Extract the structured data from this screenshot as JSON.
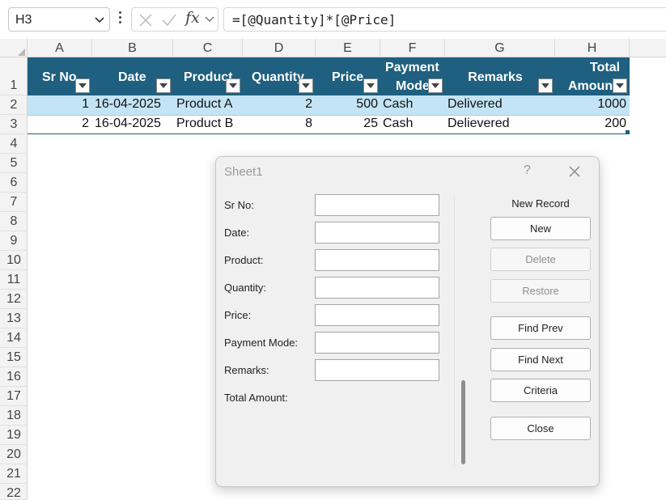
{
  "formula_bar": {
    "name_box": "H3",
    "fx_label": "fx",
    "formula": "=[@Quantity]*[@Price]"
  },
  "columns": [
    "A",
    "B",
    "C",
    "D",
    "E",
    "F",
    "G",
    "H"
  ],
  "rows": [
    "1",
    "2",
    "3",
    "4",
    "5",
    "6",
    "7",
    "8",
    "9",
    "10",
    "11",
    "12",
    "13",
    "14",
    "15",
    "16",
    "17",
    "18",
    "19",
    "20",
    "21",
    "22"
  ],
  "table": {
    "header_color": "#1f5f7f",
    "selected_row_color": "#c3e4f5",
    "headers": {
      "sr_no": "Sr No",
      "date": "Date",
      "product": "Product",
      "quantity": "Quantity",
      "price": "Price",
      "payment_mode_line1": "Payment",
      "payment_mode_line2": "Mode",
      "remarks": "Remarks",
      "total_amount_line1": "Total",
      "total_amount_line2": "Amount"
    },
    "rows": [
      {
        "sr_no": "1",
        "date": "16-04-2025",
        "product": "Product A",
        "quantity": "2",
        "price": "500",
        "payment_mode": "Cash",
        "remarks": "Delivered",
        "total_amount": "1000"
      },
      {
        "sr_no": "2",
        "date": "16-04-2025",
        "product": "Product B",
        "quantity": "8",
        "price": "25",
        "payment_mode": "Cash",
        "remarks": "Delievered",
        "total_amount": "200"
      }
    ]
  },
  "dialog": {
    "title": "Sheet1",
    "help": "?",
    "record_status": "New Record",
    "fields": {
      "sr_no": "Sr No:",
      "date": "Date:",
      "product": "Product:",
      "quantity": "Quantity:",
      "price": "Price:",
      "payment_mode": "Payment Mode:",
      "remarks": "Remarks:",
      "total_amount": "Total Amount:"
    },
    "buttons": {
      "new": "New",
      "delete": "Delete",
      "restore": "Restore",
      "find_prev": "Find Prev",
      "find_next": "Find Next",
      "criteria": "Criteria",
      "close": "Close"
    }
  }
}
